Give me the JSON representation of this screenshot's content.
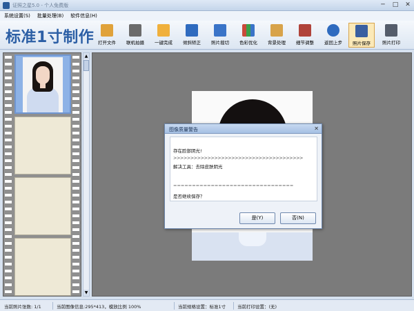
{
  "window": {
    "title": "证照之星5.0 - 个人免费版",
    "controls": [
      "─",
      "□",
      "✕"
    ]
  },
  "menu": {
    "items": [
      "系统设置(S)",
      "批量处理(B)",
      "软件信息(H)"
    ]
  },
  "brand": {
    "title": "标准1寸制作"
  },
  "toolbar": {
    "tools": [
      {
        "label": "打开文件",
        "icon": "open-folder-icon",
        "color": "#e0a23a"
      },
      {
        "label": "联机拍摄",
        "icon": "camera-icon",
        "color": "#6b6b6b"
      },
      {
        "label": "一键完成",
        "icon": "hand-click-icon",
        "color": "#f0b03c"
      },
      {
        "label": "倾斜矫正",
        "icon": "rotate-correct-icon",
        "color": "#2f6bbf"
      },
      {
        "label": "照片裁切",
        "icon": "crop-icon",
        "color": "#3a74c8"
      },
      {
        "label": "色彩优化",
        "icon": "color-bars-icon",
        "color": "#c94a3a"
      },
      {
        "label": "背景处理",
        "icon": "background-brush-icon",
        "color": "#d8a34a"
      },
      {
        "label": "细节调整",
        "icon": "detail-adjust-icon",
        "color": "#b0433a"
      },
      {
        "label": "返回上步",
        "icon": "undo-arrow-icon",
        "color": "#2f6bbf"
      },
      {
        "label": "照片保存",
        "icon": "save-disk-icon",
        "color": "#3a5fa0"
      },
      {
        "label": "照片打印",
        "icon": "printer-icon",
        "color": "#555d6b"
      }
    ]
  },
  "dialog": {
    "title": "图像质量警告",
    "close": "✕",
    "line1": "存在脸部阴光!",
    "arrows": ">>>>>>>>>>>>>>>>>>>>>>>>>>>>>>>>>>>>>>",
    "line2": "解决工具：去除皮肤阴光",
    "dashes": "================================",
    "question": "是否继续保存？",
    "yes": "是(Y)",
    "no": "否(N)"
  },
  "status": {
    "photo_count": "当前照片张数: 1/1",
    "image_info": "当前图像信息:295*413，模放比例 100%",
    "template": "当前规格设置：标准1寸",
    "print_setting": "当前打印设置：(无)"
  }
}
